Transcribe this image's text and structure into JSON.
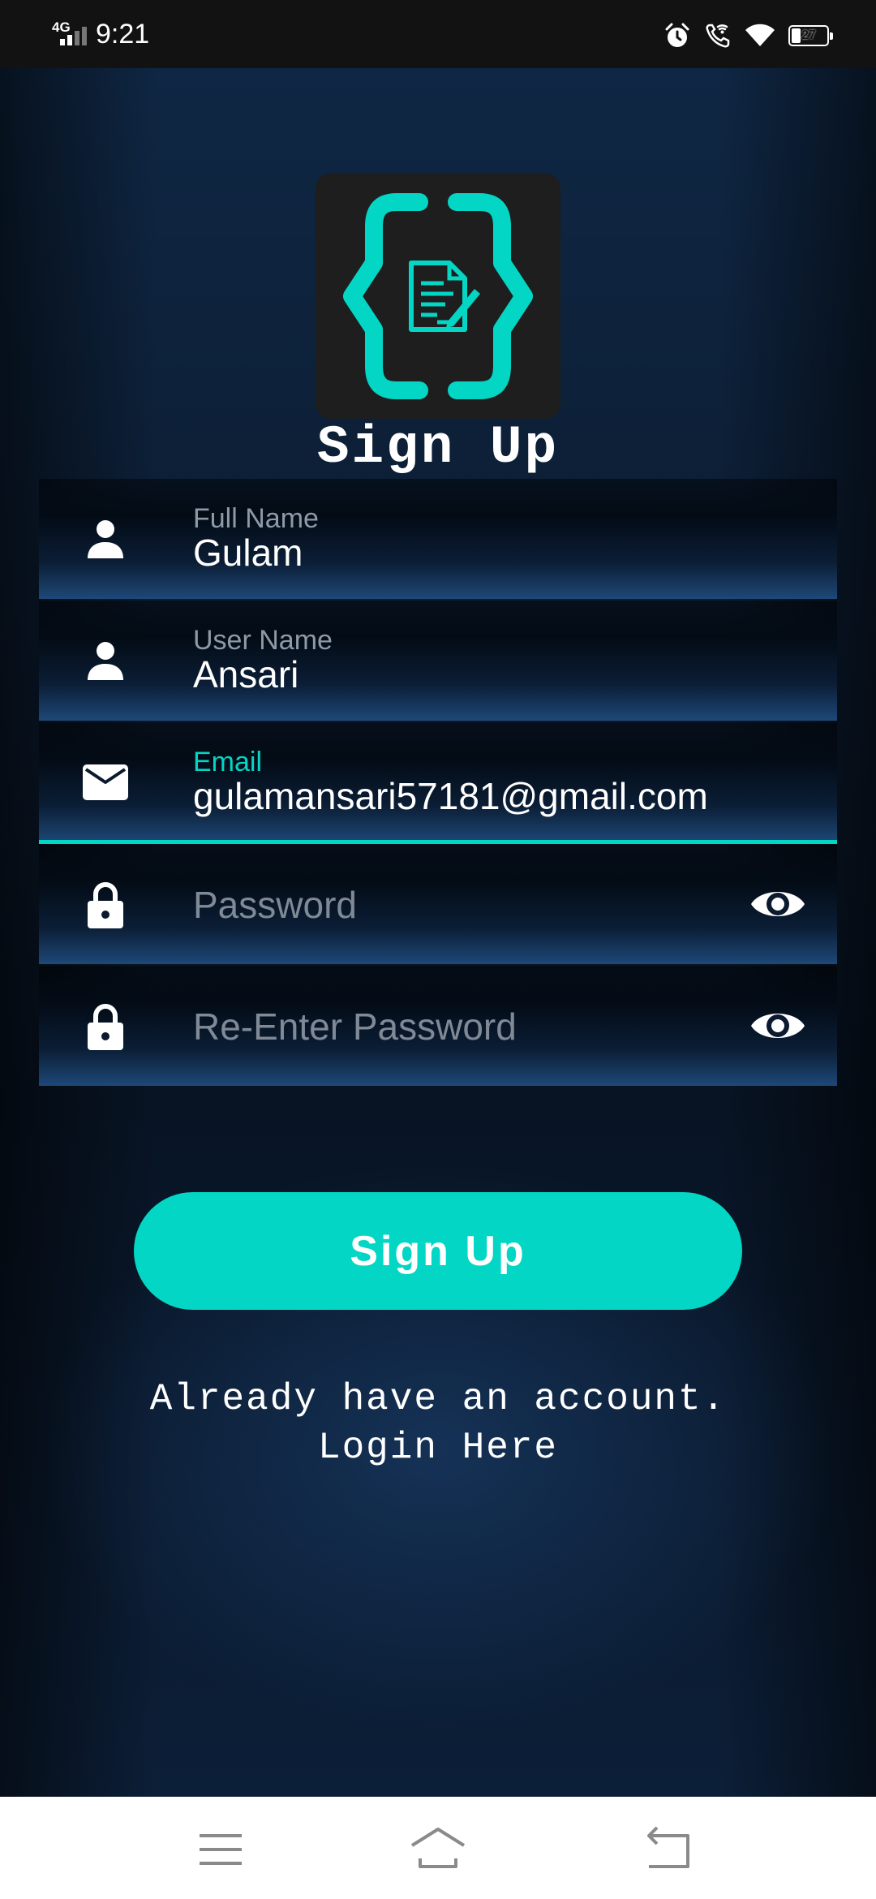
{
  "status_bar": {
    "network": "4G",
    "time": "9:21",
    "battery_level": "27",
    "battery_fraction": 0.27,
    "icons": [
      "alarm-icon",
      "wifi-calling-icon",
      "wifi-icon",
      "battery-icon"
    ]
  },
  "colors": {
    "accent": "#03d6c4",
    "background": "#0b1727",
    "field_label": "#8e9aa8",
    "placeholder": "#808a96"
  },
  "title": "Sign Up",
  "form": {
    "full_name": {
      "label": "Full Name",
      "value": "Gulam",
      "icon": "person-icon"
    },
    "user_name": {
      "label": "User Name",
      "value": "Ansari",
      "icon": "person-icon"
    },
    "email": {
      "label": "Email",
      "value": "gulamansari57181@gmail.com",
      "icon": "mail-icon",
      "focused": true
    },
    "password": {
      "placeholder": "Password",
      "icon": "lock-icon",
      "toggle_icon": "eye-icon"
    },
    "re_password": {
      "placeholder": "Re-Enter Password",
      "icon": "lock-icon",
      "toggle_icon": "eye-icon"
    }
  },
  "signup_button": "Sign Up",
  "login_prompt": {
    "line1": "Already have an account.",
    "line2": "Login Here"
  },
  "nav_bar": {
    "icons": [
      "menu-icon",
      "home-icon",
      "back-icon"
    ]
  }
}
